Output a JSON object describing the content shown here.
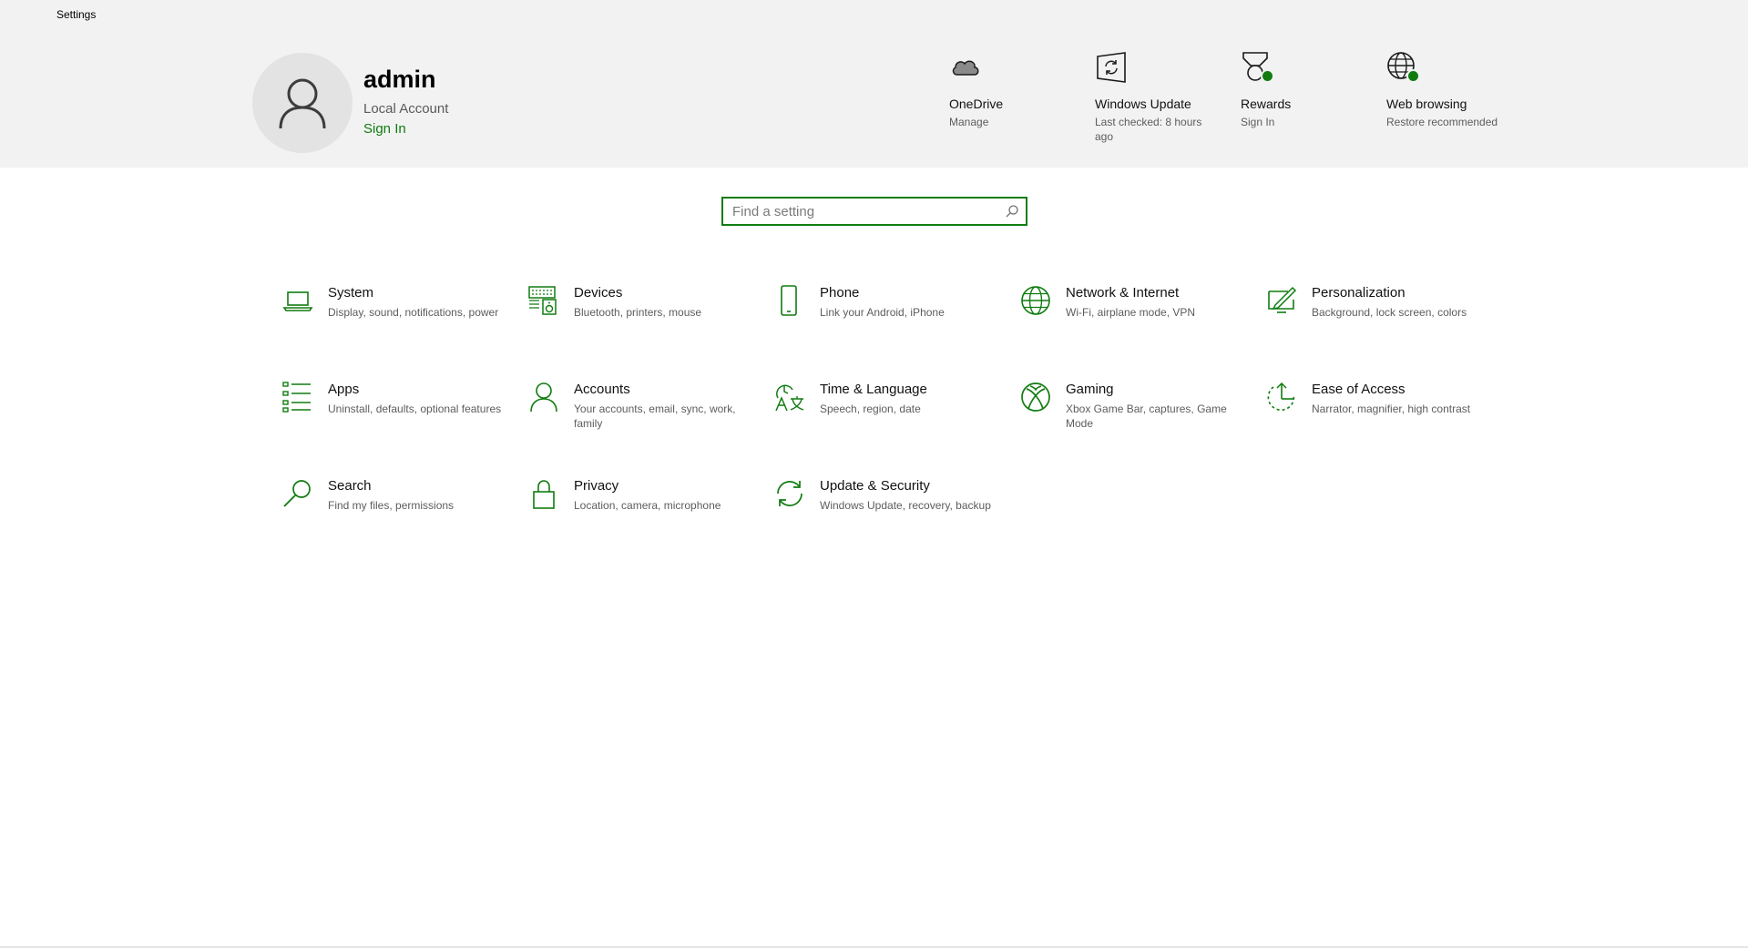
{
  "window": {
    "title": "Settings"
  },
  "account": {
    "name": "admin",
    "type": "Local Account",
    "sign_in": "Sign In"
  },
  "quick_links": [
    {
      "label": "OneDrive",
      "sub": "Manage",
      "icon": "cloud-icon"
    },
    {
      "label": "Windows Update",
      "sub": "Last checked: 8 hours ago",
      "icon": "sync-icon"
    },
    {
      "label": "Rewards",
      "sub": "Sign In",
      "icon": "medal-icon"
    },
    {
      "label": "Web browsing",
      "sub": "Restore recommended",
      "icon": "globe-icon"
    }
  ],
  "search": {
    "placeholder": "Find a setting"
  },
  "categories": [
    {
      "name": "System",
      "desc": "Display, sound, notifications, power",
      "icon": "laptop-icon"
    },
    {
      "name": "Devices",
      "desc": "Bluetooth, printers, mouse",
      "icon": "keyboard-speaker-icon"
    },
    {
      "name": "Phone",
      "desc": "Link your Android, iPhone",
      "icon": "phone-icon"
    },
    {
      "name": "Network & Internet",
      "desc": "Wi-Fi, airplane mode, VPN",
      "icon": "globe-icon"
    },
    {
      "name": "Personalization",
      "desc": "Background, lock screen, colors",
      "icon": "paint-icon"
    },
    {
      "name": "Apps",
      "desc": "Uninstall, defaults, optional features",
      "icon": "list-icon"
    },
    {
      "name": "Accounts",
      "desc": "Your accounts, email, sync, work, family",
      "icon": "person-icon"
    },
    {
      "name": "Time & Language",
      "desc": "Speech, region, date",
      "icon": "time-language-icon"
    },
    {
      "name": "Gaming",
      "desc": "Xbox Game Bar, captures, Game Mode",
      "icon": "xbox-icon"
    },
    {
      "name": "Ease of Access",
      "desc": "Narrator, magnifier, high contrast",
      "icon": "ease-of-access-icon"
    },
    {
      "name": "Search",
      "desc": "Find my files, permissions",
      "icon": "search-icon"
    },
    {
      "name": "Privacy",
      "desc": "Location, camera, microphone",
      "icon": "lock-icon"
    },
    {
      "name": "Update & Security",
      "desc": "Windows Update, recovery, backup",
      "icon": "sync-icon"
    }
  ],
  "colors": {
    "accent": "#107c10",
    "header_bg": "#f2f2f2"
  }
}
